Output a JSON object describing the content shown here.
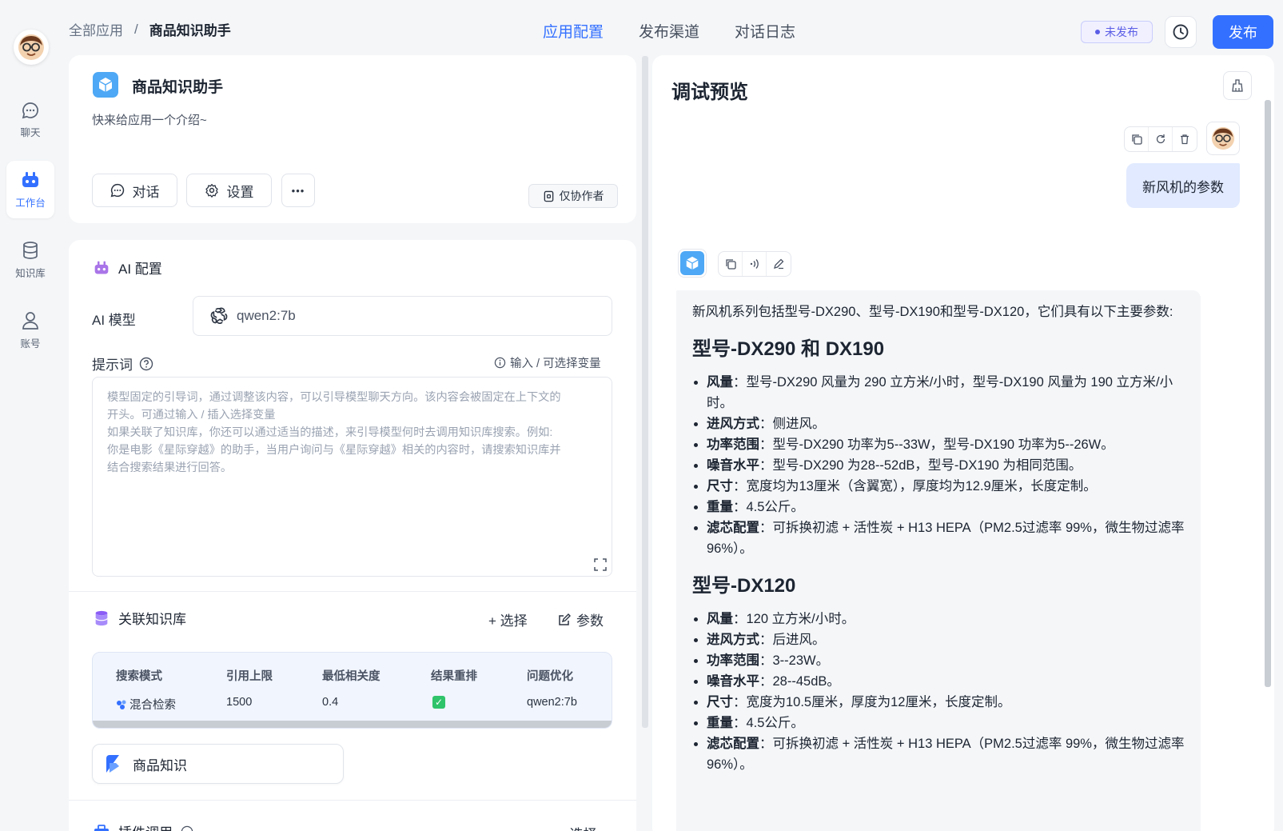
{
  "nav": {
    "items": [
      {
        "label": "聊天",
        "icon": "chat-icon"
      },
      {
        "label": "工作台",
        "icon": "robot-icon"
      },
      {
        "label": "知识库",
        "icon": "database-icon"
      },
      {
        "label": "账号",
        "icon": "user-icon"
      }
    ]
  },
  "header": {
    "breadcrumb_root": "全部应用",
    "breadcrumb_sep": "/",
    "breadcrumb_current": "商品知识助手",
    "tabs": [
      "应用配置",
      "发布渠道",
      "对话日志"
    ],
    "status_badge": "未发布",
    "publish_label": "发布"
  },
  "app": {
    "name": "商品知识助手",
    "intro": "快来给应用一个介绍~",
    "chat_btn": "对话",
    "settings_btn": "设置",
    "more_btn": "•••",
    "permission": "仅协作者"
  },
  "ai_config": {
    "title": "AI 配置",
    "model_label": "AI 模型",
    "model_value": "qwen2:7b",
    "prompt_label": "提示词",
    "prompt_hint": "输入 / 可选择变量",
    "prompt_placeholder": "模型固定的引导词，通过调整该内容，可以引导模型聊天方向。该内容会被固定在上下文的\n开头。可通过输入 / 插入选择变量\n如果关联了知识库，你还可以通过适当的描述，来引导模型何时去调用知识库搜索。例如:\n你是电影《星际穿越》的助手，当用户询问与《星际穿越》相关的内容时，请搜索知识库并\n结合搜索结果进行回答。"
  },
  "knowledge": {
    "title": "关联知识库",
    "select_btn": "+ 选择",
    "params_btn": "参数",
    "columns": [
      "搜索模式",
      "引用上限",
      "最低相关度",
      "结果重排",
      "问题优化"
    ],
    "row": {
      "mode": "混合检索",
      "limit": "1500",
      "min_score": "0.4",
      "rerank": "✓",
      "optimize": "qwen2:7b"
    },
    "dataset": "商品知识"
  },
  "plugin": {
    "title": "插件调用",
    "select_btn": "+ 选择"
  },
  "preview": {
    "title": "调试预览",
    "user_message": "新风机的参数",
    "ai_intro": "新风机系列包括型号-DX290、型号-DX190和型号-DX120，它们具有以下主要参数:",
    "sections": [
      {
        "heading": "型号-DX290 和 DX190",
        "items": [
          {
            "k": "风量",
            "v": "：型号-DX290 风量为 290 立方米/小时，型号-DX190 风量为 190 立方米/小时。"
          },
          {
            "k": "进风方式",
            "v": "：侧进风。"
          },
          {
            "k": "功率范围",
            "v": "：型号-DX290 功率为5--33W，型号-DX190 功率为5--26W。"
          },
          {
            "k": "噪音水平",
            "v": "：型号-DX290 为28--52dB，型号-DX190 为相同范围。"
          },
          {
            "k": "尺寸",
            "v": "：宽度均为13厘米（含翼宽），厚度均为12.9厘米，长度定制。"
          },
          {
            "k": "重量",
            "v": "：4.5公斤。"
          },
          {
            "k": "滤芯配置",
            "v": "：可拆换初滤 + 活性炭 + H13 HEPA（PM2.5过滤率 99%，微生物过滤率 96%）。"
          }
        ]
      },
      {
        "heading": "型号-DX120",
        "items": [
          {
            "k": "风量",
            "v": "：120 立方米/小时。"
          },
          {
            "k": "进风方式",
            "v": "：后进风。"
          },
          {
            "k": "功率范围",
            "v": "：3--23W。"
          },
          {
            "k": "噪音水平",
            "v": "：28--45dB。"
          },
          {
            "k": "尺寸",
            "v": "：宽度为10.5厘米，厚度为12厘米，长度定制。"
          },
          {
            "k": "重量",
            "v": "：4.5公斤。"
          },
          {
            "k": "滤芯配置",
            "v": "：可拆换初滤 + 活性炭 + H13 HEPA（PM2.5过滤率 99%，微生物过滤率 96%）。"
          }
        ]
      }
    ]
  },
  "colors": {
    "accent": "#3370ff",
    "badge": "#5a5de6",
    "user_bubble": "#e1eaff"
  }
}
